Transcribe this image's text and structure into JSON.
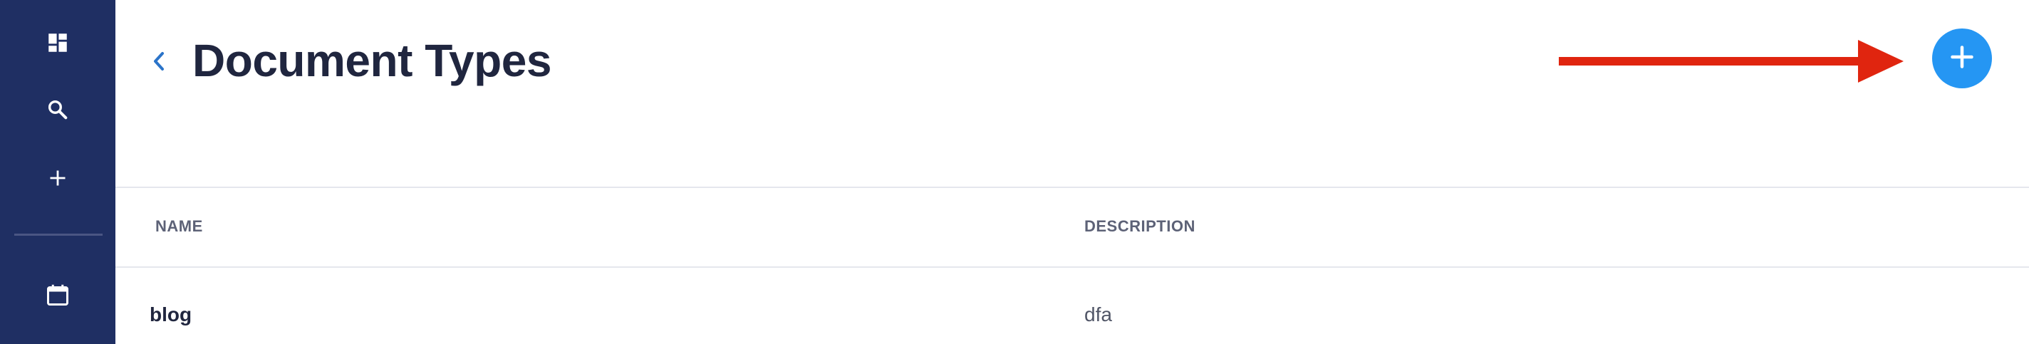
{
  "sidebar": {
    "items": [
      {
        "icon": "dashboard-icon"
      },
      {
        "icon": "search-icon"
      },
      {
        "icon": "plus-icon"
      },
      {
        "icon": "calendar-icon"
      }
    ]
  },
  "header": {
    "title": "Document Types",
    "back_icon": "chevron-left-icon",
    "add_icon": "plus-icon"
  },
  "table": {
    "columns": [
      "NAME",
      "DESCRIPTION"
    ],
    "rows": [
      {
        "name": "blog",
        "description": "dfa"
      }
    ]
  },
  "colors": {
    "sidebar": "#1f2f63",
    "accent": "#2596f3",
    "annotation_arrow": "#e0250f",
    "title": "#20263f"
  }
}
